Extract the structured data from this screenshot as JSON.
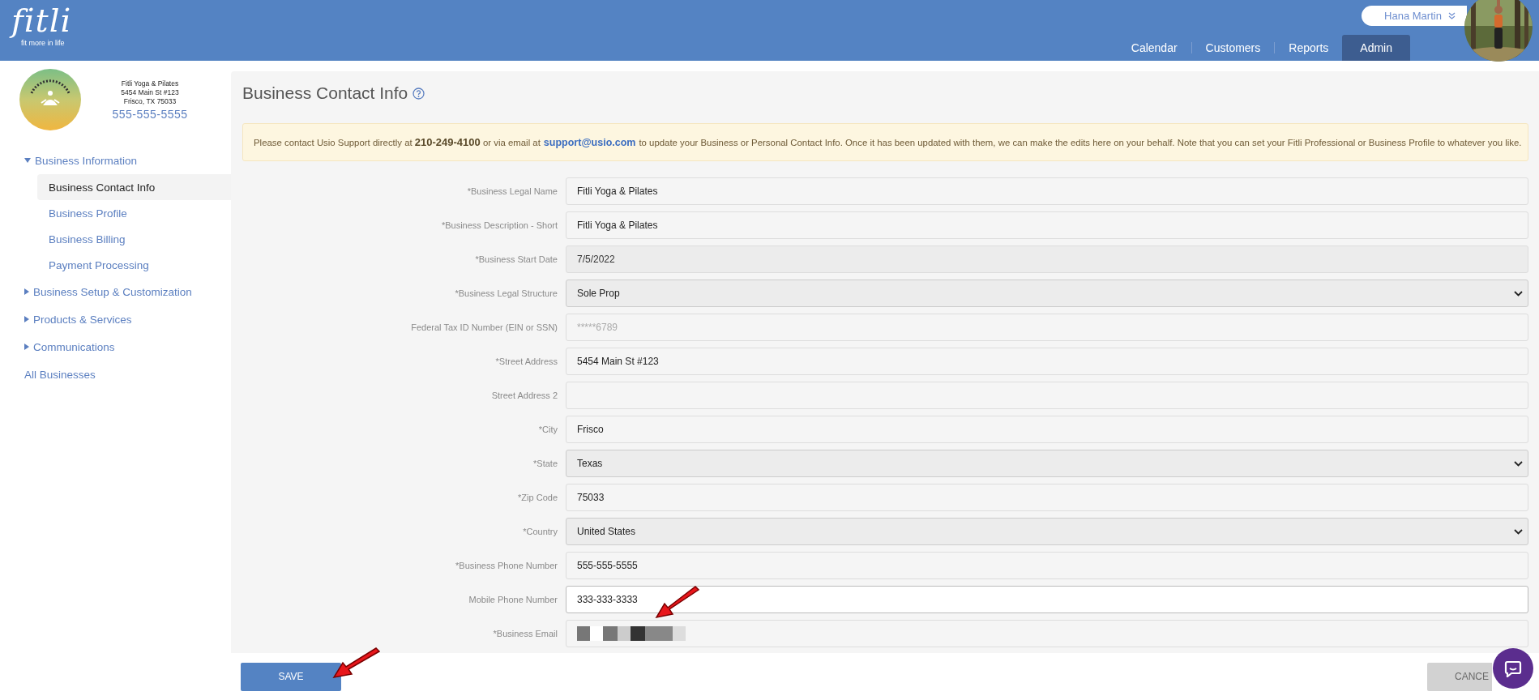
{
  "brand": {
    "logo": "fitli",
    "tagline": "fit more in life"
  },
  "user": {
    "name": "Hana Martin"
  },
  "nav": [
    {
      "label": "Calendar",
      "selected": false
    },
    {
      "label": "Customers",
      "selected": false
    },
    {
      "label": "Reports",
      "selected": false
    },
    {
      "label": "Admin",
      "selected": true
    }
  ],
  "business_card": {
    "lines": [
      "Fitli Yoga & Pilates",
      "5454 Main St #123",
      "Frisco, TX 75033"
    ],
    "phone": "555-555-5555"
  },
  "sidebar": {
    "items": [
      {
        "label": "Business Information",
        "expanded": true,
        "children": [
          {
            "label": "Business Contact Info",
            "selected": true
          },
          {
            "label": "Business Profile",
            "selected": false
          },
          {
            "label": "Business Billing",
            "selected": false
          },
          {
            "label": "Payment Processing",
            "selected": false
          }
        ]
      },
      {
        "label": "Business Setup & Customization",
        "expanded": false
      },
      {
        "label": "Products & Services",
        "expanded": false
      },
      {
        "label": "Communications",
        "expanded": false
      },
      {
        "label": "All Businesses"
      }
    ]
  },
  "page": {
    "title": "Business Contact Info"
  },
  "notice": {
    "before_link": "Please contact Usio Support directly at **210-249-4100** or via email at",
    "link": "support@usio.com",
    "after_link": "to update your Business or Personal Contact Info. Once it has been updated with them, we can make the edits here on your behalf. Note that you can set your Fitli Professional or Business Profile to whatever you like."
  },
  "fields": [
    {
      "label": "*Business Legal Name",
      "kind": "input",
      "value": "Fitli Yoga & Pilates"
    },
    {
      "label": "*Business Description - Short",
      "kind": "input",
      "value": "Fitli Yoga & Pilates"
    },
    {
      "label": "*Business Start Date",
      "kind": "input",
      "value": "7/5/2022",
      "disabled": true
    },
    {
      "label": "*Business Legal Structure",
      "kind": "select",
      "value": "Sole Prop"
    },
    {
      "label": "Federal Tax ID Number (EIN or SSN)",
      "kind": "input",
      "placeholder": "*****6789"
    },
    {
      "label": "*Street Address",
      "kind": "input",
      "value": "5454 Main St #123"
    },
    {
      "label": "Street Address 2",
      "kind": "input"
    },
    {
      "label": "*City",
      "kind": "input",
      "value": "Frisco"
    },
    {
      "label": "*State",
      "kind": "select",
      "value": "Texas"
    },
    {
      "label": "*Zip Code",
      "kind": "input",
      "value": "75033"
    },
    {
      "label": "*Country",
      "kind": "select",
      "value": "United States"
    },
    {
      "label": "*Business Phone Number",
      "kind": "input",
      "value": "555-555-5555"
    },
    {
      "label": "Mobile Phone Number",
      "kind": "input",
      "value": "333-333-3333",
      "focused": true
    },
    {
      "label": "*Business Email",
      "kind": "redacted"
    }
  ],
  "buttons": [
    {
      "label": "SAVE",
      "kind": "primary"
    },
    {
      "label": "CANCE",
      "kind": "secondary"
    }
  ]
}
